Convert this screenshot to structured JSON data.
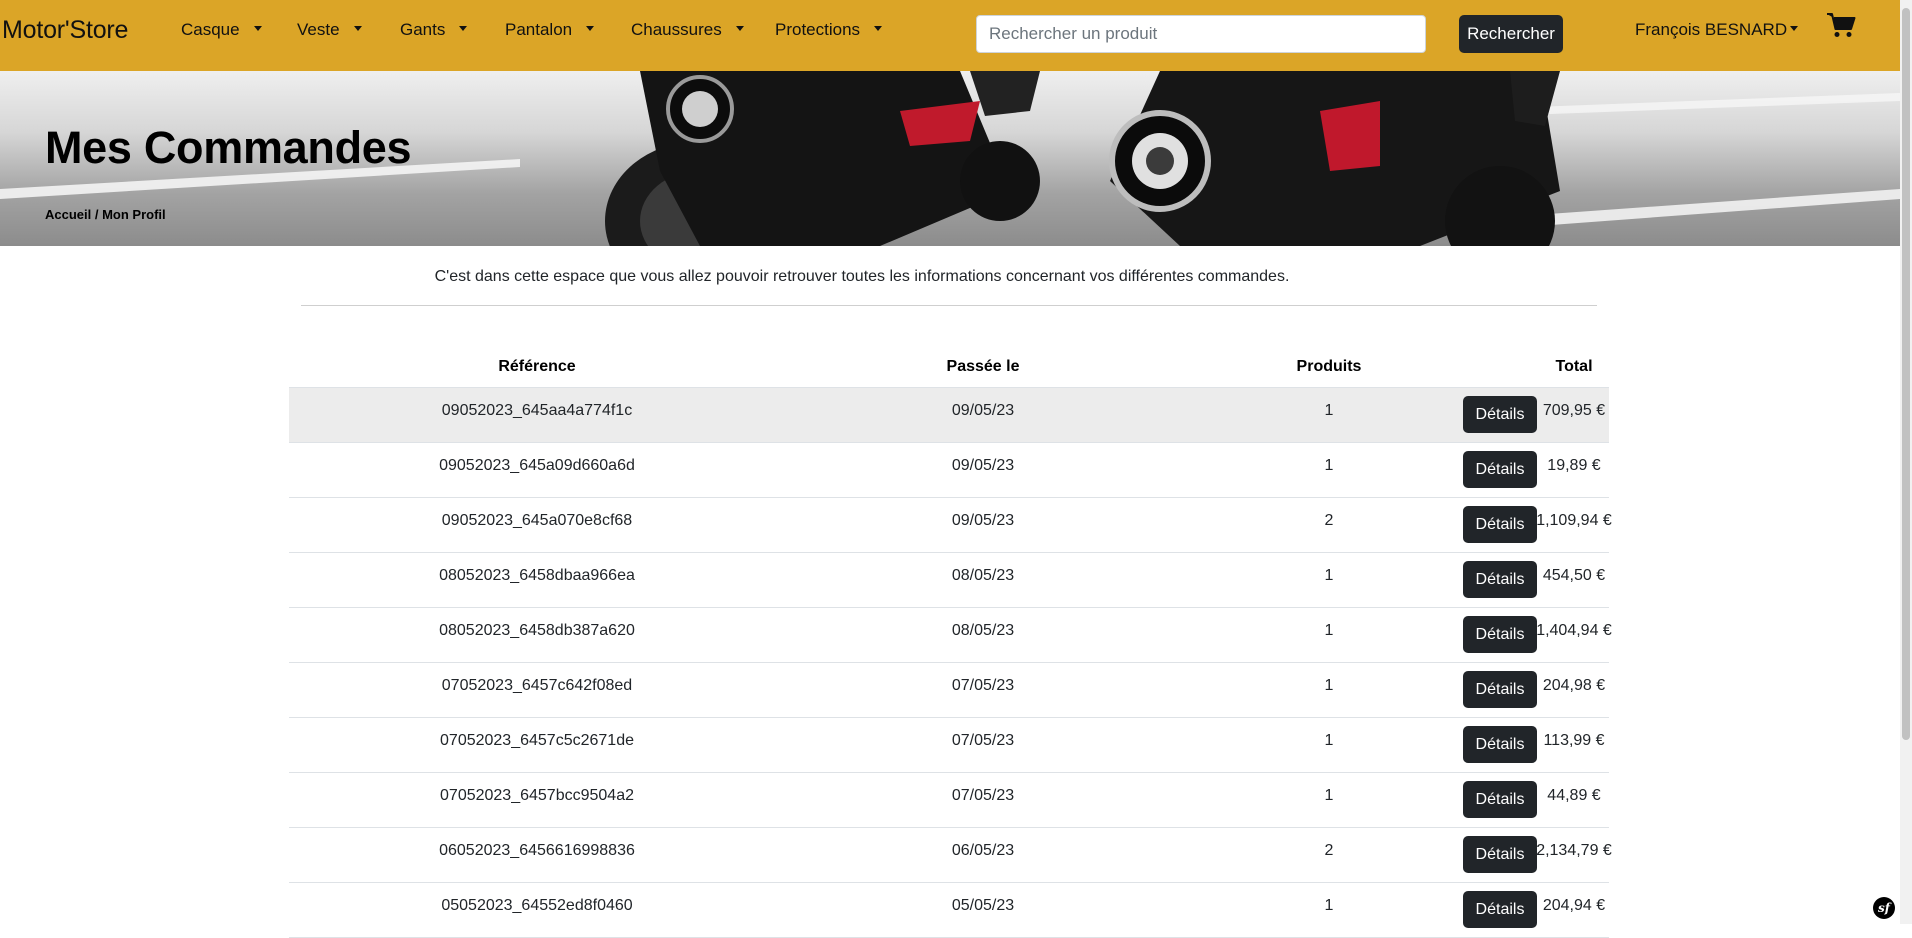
{
  "colors": {
    "navbar": "#dba527",
    "button": "#212529",
    "row_highlight": "#ececec"
  },
  "navbar": {
    "brand": "Motor'Store",
    "menu": [
      {
        "label": "Casque"
      },
      {
        "label": "Veste"
      },
      {
        "label": "Gants"
      },
      {
        "label": "Pantalon"
      },
      {
        "label": "Chaussures"
      },
      {
        "label": "Protections"
      }
    ],
    "search": {
      "placeholder": "Rechercher un produit",
      "button_label": "Rechercher"
    },
    "user": "François BESNARD",
    "cart_icon": "cart-icon"
  },
  "hero": {
    "title": "Mes Commandes",
    "breadcrumb": {
      "home": "Accueil",
      "separator": " / ",
      "current": "Mon Profil"
    }
  },
  "intro": "C'est dans cette espace que vous allez pouvoir retrouver toutes les informations concernant vos différentes commandes.",
  "table": {
    "headers": {
      "reference": "Référence",
      "date": "Passée le",
      "products": "Produits",
      "total": "Total"
    },
    "rows": [
      {
        "reference": "09052023_645aa4a774f1c",
        "date": "09/05/23",
        "products": "1",
        "total": "709,95 €",
        "action": "Détails"
      },
      {
        "reference": "09052023_645a09d660a6d",
        "date": "09/05/23",
        "products": "1",
        "total": "19,89 €",
        "action": "Détails"
      },
      {
        "reference": "09052023_645a070e8cf68",
        "date": "09/05/23",
        "products": "2",
        "total": "1,109,94 €",
        "action": "Détails"
      },
      {
        "reference": "08052023_6458dbaa966ea",
        "date": "08/05/23",
        "products": "1",
        "total": "454,50 €",
        "action": "Détails"
      },
      {
        "reference": "08052023_6458db387a620",
        "date": "08/05/23",
        "products": "1",
        "total": "1,404,94 €",
        "action": "Détails"
      },
      {
        "reference": "07052023_6457c642f08ed",
        "date": "07/05/23",
        "products": "1",
        "total": "204,98 €",
        "action": "Détails"
      },
      {
        "reference": "07052023_6457c5c2671de",
        "date": "07/05/23",
        "products": "1",
        "total": "113,99 €",
        "action": "Détails"
      },
      {
        "reference": "07052023_6457bcc9504a2",
        "date": "07/05/23",
        "products": "1",
        "total": "44,89 €",
        "action": "Détails"
      },
      {
        "reference": "06052023_6456616998836",
        "date": "06/05/23",
        "products": "2",
        "total": "2,134,79 €",
        "action": "Détails"
      },
      {
        "reference": "05052023_64552ed8f0460",
        "date": "05/05/23",
        "products": "1",
        "total": "204,94 €",
        "action": "Détails"
      }
    ]
  },
  "debug_toolbar": {
    "icon": "symfony-icon",
    "label": "sf"
  }
}
